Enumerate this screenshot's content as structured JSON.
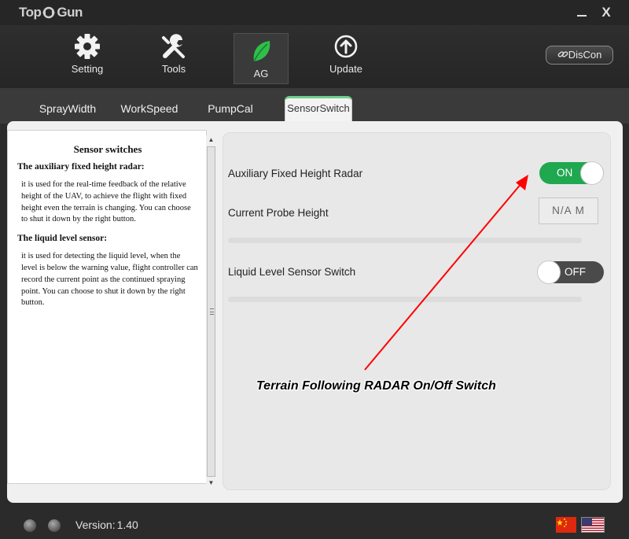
{
  "app": {
    "logo_left": "Top",
    "logo_right": "Gun",
    "minimize_label": "",
    "close_label": "X"
  },
  "toolbar": {
    "items": [
      {
        "label": "Setting",
        "icon": "gear-icon"
      },
      {
        "label": "Tools",
        "icon": "wrench-icon"
      },
      {
        "label": "AG",
        "icon": "leaf-icon",
        "active": true
      },
      {
        "label": "Update",
        "icon": "arrow-up-circle-icon"
      }
    ],
    "disconnect_label": "DisCon"
  },
  "tabs": [
    {
      "label": "SprayWidth"
    },
    {
      "label": "WorkSpeed"
    },
    {
      "label": "PumpCal"
    },
    {
      "label": "SensorSwitch",
      "active": true
    }
  ],
  "help": {
    "title": "Sensor switches",
    "sections": [
      {
        "heading": "The auxiliary fixed height radar:",
        "body": "it is used for the real-time feedback of the relative height of the UAV, to achieve the flight with fixed height even the terrain is changing. You can choose to shut it down by the right button."
      },
      {
        "heading": "The liquid level sensor:",
        "body": "it is used for detecting the liquid level, when the level is below the warning value, flight controller can record the current point as the continued spraying point. You can choose to shut it down by the right button."
      }
    ]
  },
  "settings": {
    "radar_label": "Auxiliary Fixed Height Radar",
    "radar_state": "ON",
    "probe_label": "Current Probe Height",
    "probe_value": "N/A  M",
    "liquid_label": "Liquid Level Sensor Switch",
    "liquid_state": "OFF"
  },
  "annotation": {
    "text": "Terrain Following RADAR On/Off Switch",
    "color": "#ff0000"
  },
  "footer": {
    "version_label": "Version:",
    "version_number": "1.40"
  },
  "colors": {
    "accent_green": "#1fa84f",
    "leaf_green": "#2fbf4a"
  }
}
